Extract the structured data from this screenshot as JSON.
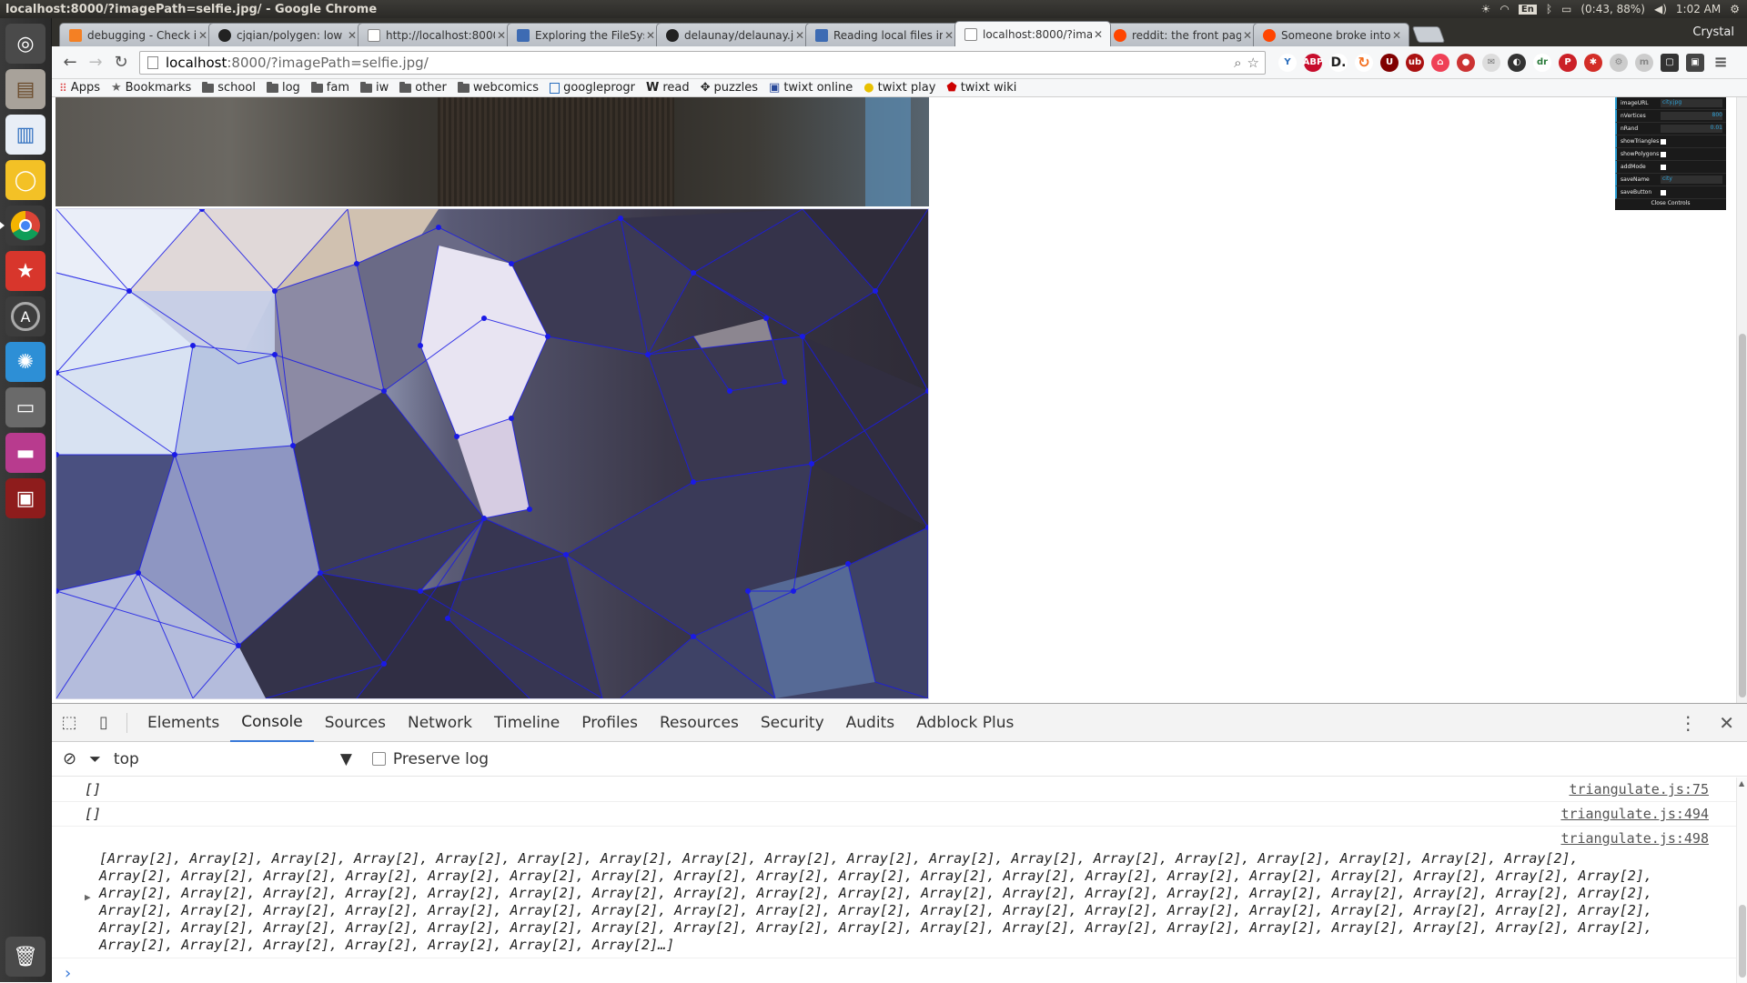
{
  "os": {
    "window_title": "localhost:8000/?imagePath=selfie.jpg/ - Google Chrome",
    "battery": "(0:43, 88%)",
    "time": "1:02 AM",
    "keyboard": "En"
  },
  "launcher": {
    "items": [
      "ubuntu-dash",
      "files",
      "writer",
      "ideas",
      "chrome",
      "starred-app",
      "software-updater",
      "weather",
      "drive",
      "photos",
      "terminal",
      "trash"
    ]
  },
  "browser": {
    "tabs": [
      {
        "label": "debugging - Check if ob",
        "icon": "stackoverflow-icon",
        "active": false
      },
      {
        "label": "cjqian/polygen: low pol",
        "icon": "github-icon",
        "active": false
      },
      {
        "label": "http://localhost:8000/?",
        "icon": "page-icon",
        "active": false
      },
      {
        "label": "Exploring the FileSyste",
        "icon": "html5-icon",
        "active": false
      },
      {
        "label": "delaunay/delaunay.js at",
        "icon": "github-icon",
        "active": false
      },
      {
        "label": "Reading local files in Ja",
        "icon": "html5-icon",
        "active": false
      },
      {
        "label": "localhost:8000/?imageP",
        "icon": "page-icon",
        "active": true
      },
      {
        "label": "reddit: the front page o",
        "icon": "reddit-icon",
        "active": false
      },
      {
        "label": "Someone broke into Fli",
        "icon": "reddit-icon",
        "active": false
      }
    ],
    "profile": "Crystal",
    "url_host": "localhost",
    "url_rest": ":8000/?imagePath=selfie.jpg/",
    "bookmarks": [
      {
        "label": "Apps",
        "icon": "apps-grid-icon"
      },
      {
        "label": "Bookmarks",
        "icon": "star-icon"
      },
      {
        "label": "school",
        "icon": "folder-icon"
      },
      {
        "label": "log",
        "icon": "folder-icon"
      },
      {
        "label": "fam",
        "icon": "folder-icon"
      },
      {
        "label": "iw",
        "icon": "folder-icon"
      },
      {
        "label": "other",
        "icon": "folder-icon"
      },
      {
        "label": "webcomics",
        "icon": "folder-icon"
      },
      {
        "label": "googleprogr",
        "icon": "page-icon"
      },
      {
        "label": "read",
        "icon": "w-icon"
      },
      {
        "label": "puzzles",
        "icon": "puzzle-icon"
      },
      {
        "label": "twixt online",
        "icon": "twixt-icon"
      },
      {
        "label": "twixt play",
        "icon": "twixt-icon"
      },
      {
        "label": "twixt wiki",
        "icon": "twixt-icon"
      }
    ]
  },
  "gui": {
    "rows": [
      {
        "label": "imageURL",
        "value": "city.jpg",
        "kind": "text"
      },
      {
        "label": "nVertices",
        "value": "800",
        "kind": "slider"
      },
      {
        "label": "nRand",
        "value": "0.01",
        "kind": "slider"
      },
      {
        "label": "showTriangles",
        "value": "",
        "kind": "check"
      },
      {
        "label": "showPolygons",
        "value": "",
        "kind": "check"
      },
      {
        "label": "addMode",
        "value": "",
        "kind": "check"
      },
      {
        "label": "saveName",
        "value": "city",
        "kind": "text"
      },
      {
        "label": "saveButton",
        "value": "",
        "kind": "check"
      }
    ],
    "close": "Close Controls"
  },
  "devtools": {
    "tabs": [
      "Elements",
      "Console",
      "Sources",
      "Network",
      "Timeline",
      "Profiles",
      "Resources",
      "Security",
      "Audits",
      "Adblock Plus"
    ],
    "active_tab": "Console",
    "context": "top",
    "preserve_log": "Preserve log",
    "console": [
      {
        "text": "[]",
        "src": "triangulate.js:75"
      },
      {
        "text": "[]",
        "src": "triangulate.js:494"
      },
      {
        "text": "[Array[2], Array[2], Array[2], Array[2], Array[2], Array[2], Array[2], Array[2], Array[2], Array[2], Array[2], Array[2], Array[2], Array[2], Array[2], Array[2], Array[2], Array[2], Array[2], Array[2], Array[2], Array[2], Array[2], Array[2], Array[2], Array[2], Array[2], Array[2], Array[2], Array[2], Array[2], Array[2], Array[2], Array[2], Array[2], Array[2], Array[2], Array[2], Array[2], Array[2], Array[2], Array[2], Array[2], Array[2], Array[2], Array[2], Array[2], Array[2], Array[2], Array[2], Array[2], Array[2], Array[2], Array[2], Array[2], Array[2], Array[2], Array[2], Array[2], Array[2], Array[2], Array[2], Array[2], Array[2], Array[2], Array[2], Array[2], Array[2], Array[2], Array[2], Array[2], Array[2], Array[2], Array[2], Array[2], Array[2], Array[2], Array[2], Array[2], Array[2], Array[2], Array[2], Array[2], Array[2], Array[2], Array[2], Array[2], Array[2], Array[2], Array[2], Array[2], Array[2], Array[2], Array[2], Array[2], Array[2], Array[2], Array[2], Array[2], Array[2], Array[2]…]",
        "src": "triangulate.js:498"
      }
    ]
  }
}
